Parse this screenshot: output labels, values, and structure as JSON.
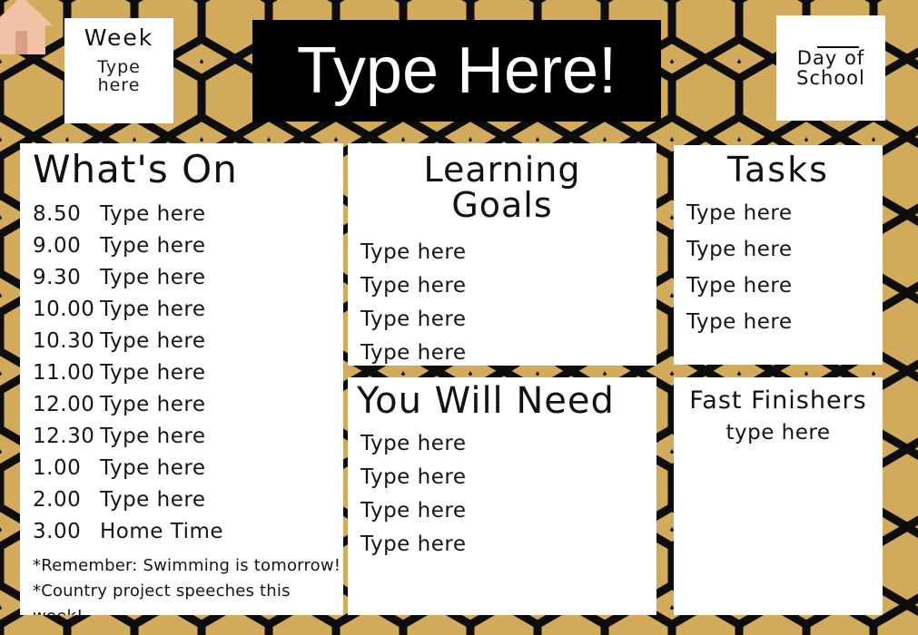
{
  "background": {
    "pattern": "gold-hexagon",
    "gold": "#d2aa5c",
    "line": "#0d0d0d"
  },
  "header": {
    "house_icon": "house-icon",
    "house_color": "#f2c1a6",
    "week_card": {
      "title": "Week",
      "line1": "Type",
      "line2": "here"
    },
    "title_banner": {
      "text": "Type Here!",
      "background": "#000000",
      "color": "#ffffff"
    },
    "day_card": {
      "line1": "Day of",
      "line2": "School"
    }
  },
  "panels": {
    "whats_on": {
      "heading": "What's On",
      "rows": [
        {
          "time": "8.50",
          "value": "Type here"
        },
        {
          "time": "9.00",
          "value": "Type here"
        },
        {
          "time": "9.30",
          "value": "Type here"
        },
        {
          "time": "10.00",
          "value": "Type here"
        },
        {
          "time": "10.30",
          "value": "Type here"
        },
        {
          "time": "11.00",
          "value": "Type here"
        },
        {
          "time": "12.00",
          "value": "Type here"
        },
        {
          "time": "12.30",
          "value": "Type here"
        },
        {
          "time": "1.00",
          "value": "Type here"
        },
        {
          "time": "2.00",
          "value": "Type here"
        },
        {
          "time": "3.00",
          "value": "Home Time"
        }
      ],
      "notes": [
        "*Remember: Swimming is tomorrow!",
        "*Country project speeches this week!"
      ]
    },
    "learning_goals": {
      "heading_line1": "Learning",
      "heading_line2": "Goals",
      "items": [
        "Type here",
        "Type here",
        "Type here",
        "Type here"
      ]
    },
    "you_will_need": {
      "heading": "You Will Need",
      "items": [
        "Type here",
        "Type here",
        "Type here",
        "Type here"
      ]
    },
    "tasks": {
      "heading": "Tasks",
      "items": [
        "Type here",
        "Type here",
        "Type here",
        "Type here"
      ]
    },
    "fast_finishers": {
      "heading": "Fast Finishers",
      "sub": "type here"
    }
  }
}
